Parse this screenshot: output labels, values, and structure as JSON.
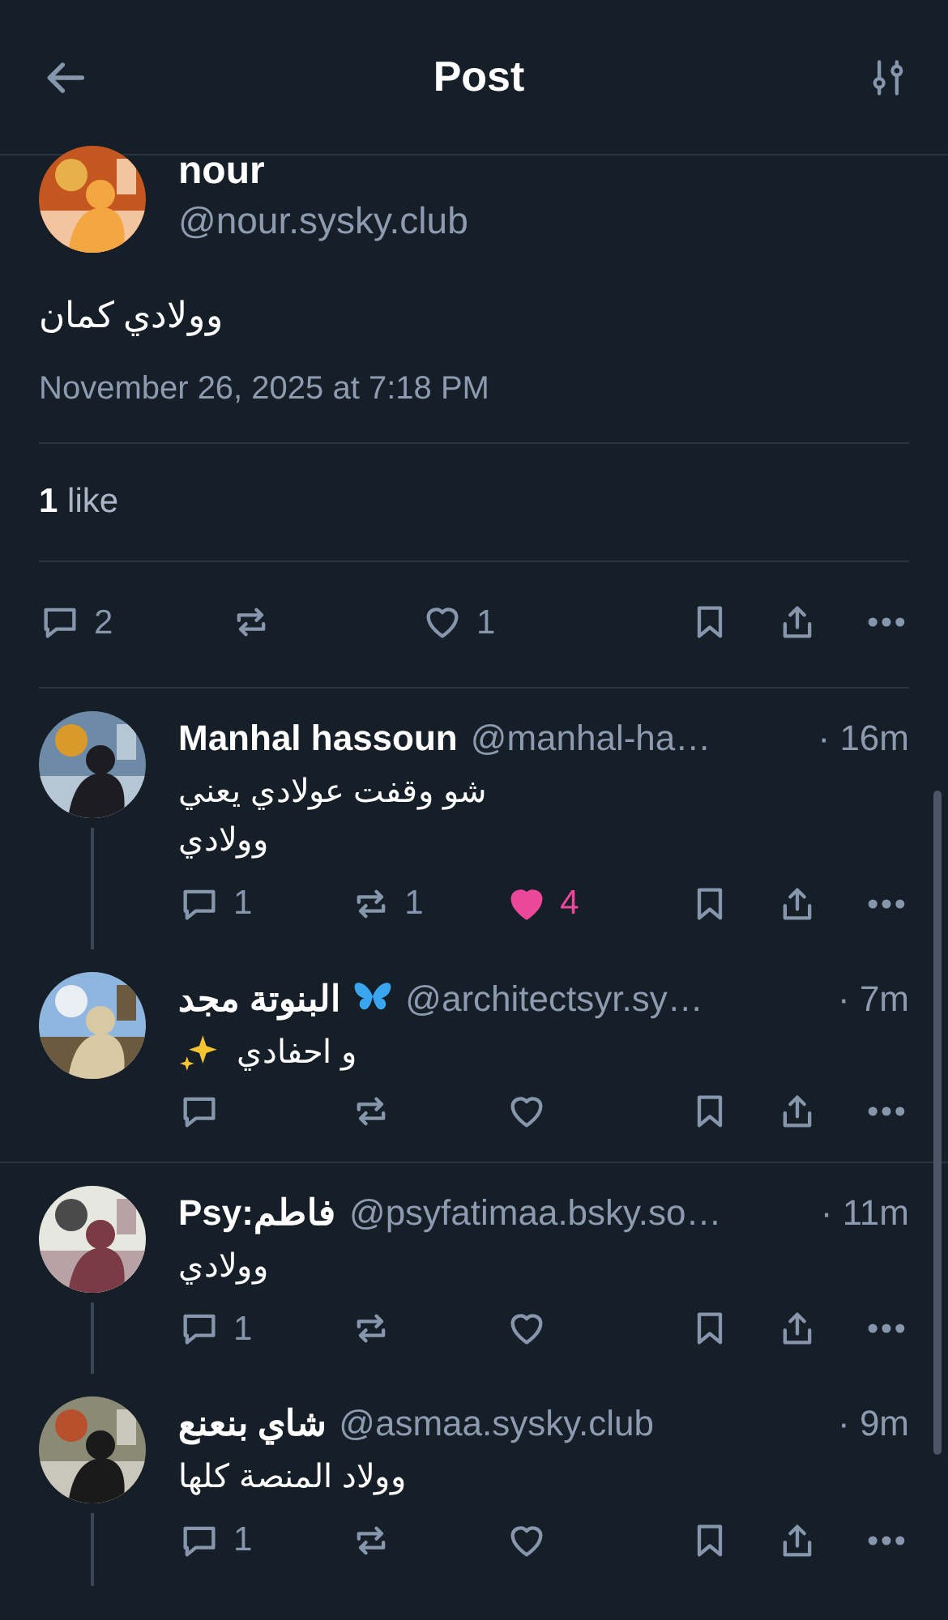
{
  "header": {
    "title": "Post"
  },
  "post": {
    "author": "nour",
    "handle": "@nour.sysky.club",
    "text": "وولادي كمان",
    "timestamp": "November 26, 2025 at 7:18 PM",
    "stats": "**1** like",
    "actions": {
      "replies": "2",
      "likes": "1",
      "liked": false
    }
  },
  "replies": [
    {
      "name": "Manhal hassoun",
      "handle": "@manhal-ha…",
      "time": "· 16m",
      "text": "شو وقفت عولادي يعني\nوولادي",
      "name_emoji": false,
      "text_emoji": false,
      "thread_line": true,
      "divider_below": false,
      "replies": "1",
      "reposts": "1",
      "likes": "4",
      "liked": true
    },
    {
      "name": "البنوتة مجد",
      "handle": "@architectsyr.sy…",
      "time": "· 7m",
      "text": "و احفادي",
      "name_emoji": true,
      "text_emoji": true,
      "thread_line": false,
      "divider_below": true,
      "liked": false
    },
    {
      "name": "Psy:فاطم",
      "handle": "@psyfatimaa.bsky.so…",
      "time": "· 11m",
      "text": "وولادي",
      "name_emoji": false,
      "text_emoji": false,
      "thread_line": true,
      "divider_below": false,
      "replies": "1",
      "liked": false
    },
    {
      "name": "شاي بنعنع",
      "handle": "@asmaa.sysky.club",
      "time": "· 9m",
      "text": "وولاد المنصة كلها",
      "name_emoji": false,
      "text_emoji": false,
      "thread_line": true,
      "divider_below": false,
      "replies": "1",
      "liked": false
    }
  ]
}
